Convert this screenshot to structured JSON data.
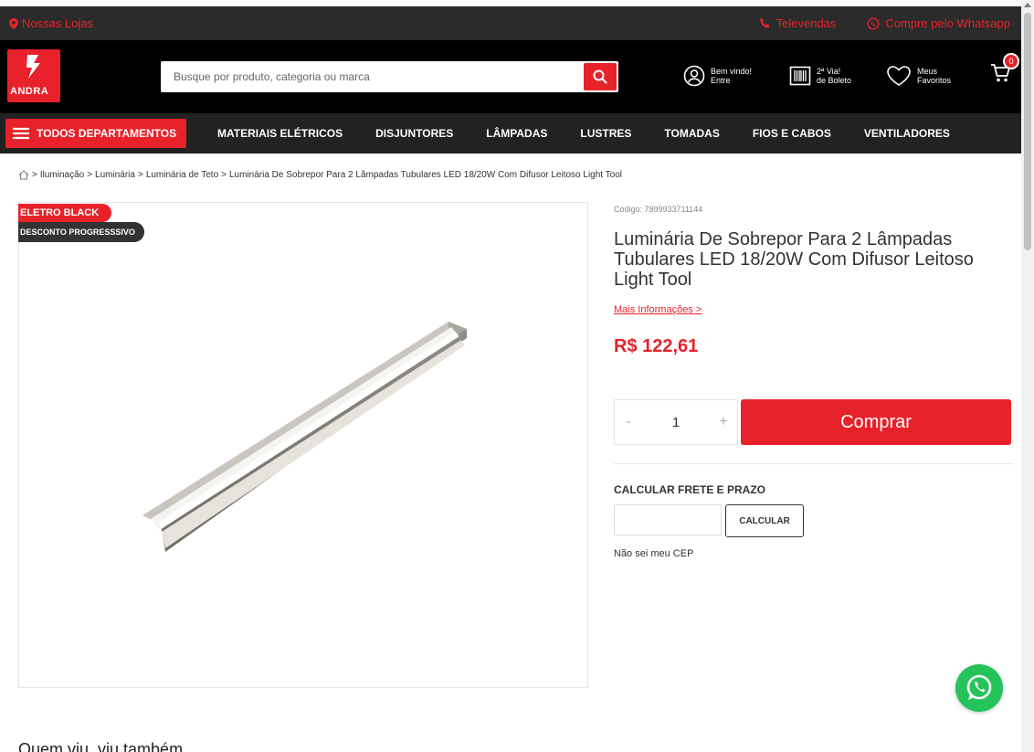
{
  "topbar": {
    "stores_label": "Nossas Lojas",
    "phone_label": "Televendas",
    "whatsapp_label": "Compre pelo Whatsapp"
  },
  "header": {
    "logo_text": "ANDRA",
    "search_placeholder": "Busque por produto, categoria ou marca",
    "account_line1": "Bem vindo!",
    "account_line2": "Entre",
    "boleto_line1": "2ª Via!",
    "boleto_line2": "de Boleto",
    "favorites_line1": "Meus",
    "favorites_line2": "Favoritos",
    "cart_count": "0"
  },
  "nav": {
    "all_departments": "TODOS DEPARTAMENTOS",
    "links": [
      "MATERIAIS ELÉTRICOS",
      "DISJUNTORES",
      "LÂMPADAS",
      "LUSTRES",
      "TOMADAS",
      "FIOS E CABOS",
      "VENTILADORES"
    ]
  },
  "breadcrumb": {
    "items": [
      "Iluminação",
      "Luminária",
      "Luminária de Teto",
      "Luminária De Sobrepor Para 2 Lâmpadas Tubulares LED 18/20W Com Difusor Leitoso Light Tool"
    ]
  },
  "product": {
    "badge_primary": "ELETRO BLACK",
    "badge_secondary": "DESCONTO PROGRESSSIVO",
    "code": "Código: 7899933711144",
    "title": "Luminária De Sobrepor Para 2 Lâmpadas Tubulares LED 18/20W Com Difusor Leitoso Light Tool",
    "more_info": "Mais Informações >",
    "price": "R$ 122,61",
    "qty_minus": "-",
    "qty_value": "1",
    "qty_plus": "+",
    "buy_label": "Comprar"
  },
  "shipping": {
    "title": "CALCULAR FRETE E PRAZO",
    "cep_value": "",
    "calc_label": "CALCULAR",
    "no_cep": "Não sei meu CEP"
  },
  "related": {
    "title": "Quem viu, viu também"
  },
  "colors": {
    "brand_red": "#e8222a",
    "header_black": "#000000",
    "whatsapp_green": "#25c45b"
  }
}
